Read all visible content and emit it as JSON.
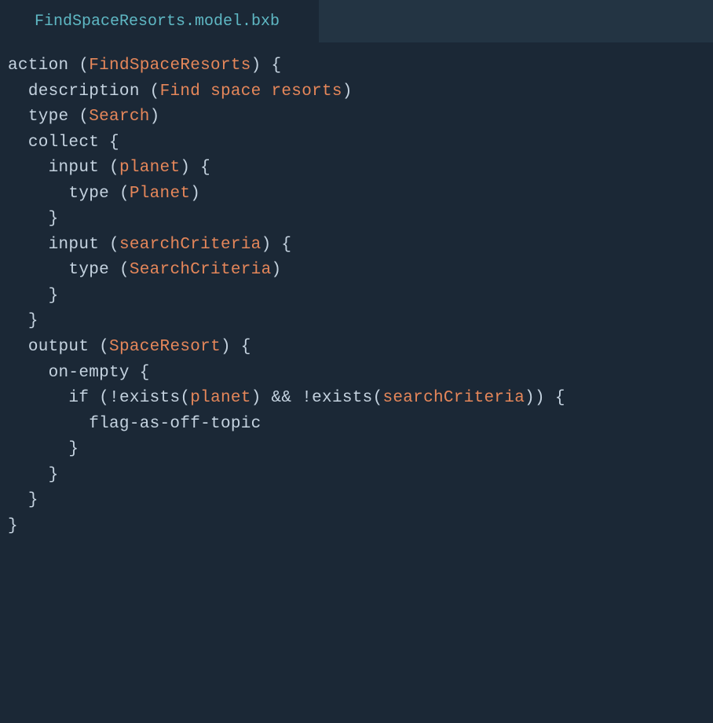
{
  "tab": {
    "filename": "FindSpaceResorts.model.bxb"
  },
  "code": {
    "tokens": {
      "action": "action",
      "description": "description",
      "type": "type",
      "collect": "collect",
      "input": "input",
      "output": "output",
      "onEmpty": "on-empty",
      "if": "if",
      "exists": "exists",
      "flagAsOffTopic": "flag-as-off-topic",
      "and": "&&",
      "bang": "!"
    },
    "identifiers": {
      "actionName": "FindSpaceResorts",
      "descriptionText": "Find space resorts",
      "typeSearch": "Search",
      "planet": "planet",
      "planetType": "Planet",
      "searchCriteria": "searchCriteria",
      "searchCriteriaType": "SearchCriteria",
      "spaceResort": "SpaceResort"
    }
  }
}
